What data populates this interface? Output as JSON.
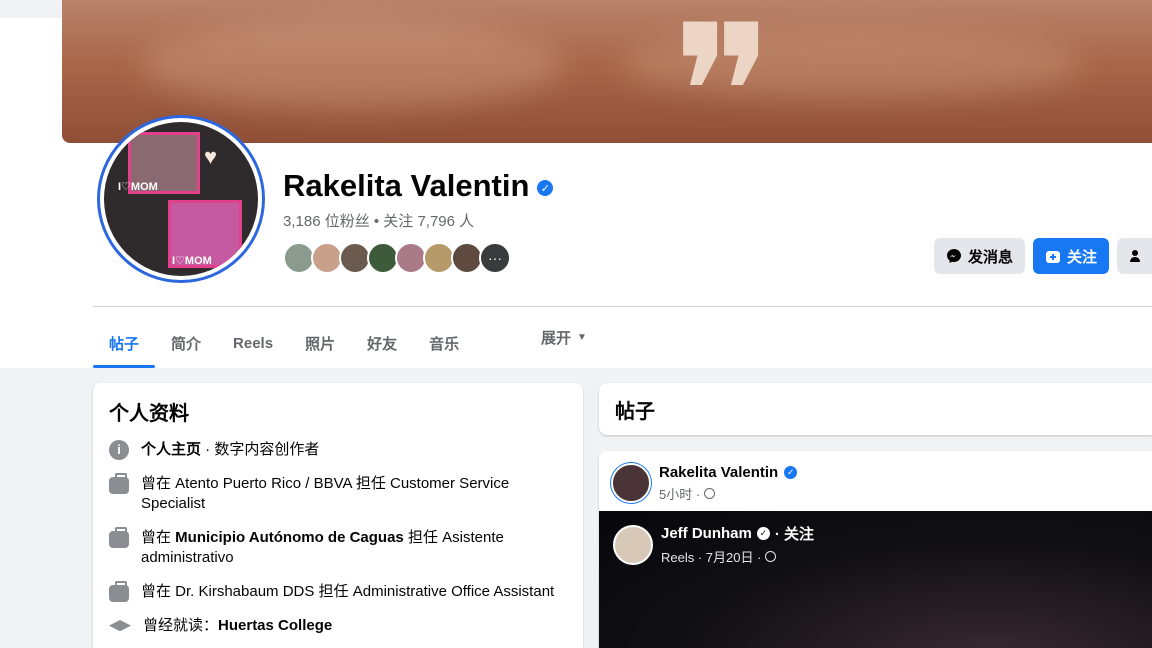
{
  "profile": {
    "name": "Rakelita Valentin",
    "stats": "3,186 位粉丝 • 关注 7,796 人",
    "avatar_text_top": "I♡MOM",
    "avatar_text_bottom": "I♡MOM"
  },
  "friends_avatar_colors": [
    "#8a9b8e",
    "#c9a08a",
    "#6b5a4e",
    "#3d5a3a",
    "#a87b86",
    "#b69a6a",
    "#5e4a3e"
  ],
  "actions": {
    "message_label": "发消息",
    "follow_label": "关注"
  },
  "tabs": [
    {
      "label": "帖子",
      "active": true
    },
    {
      "label": "简介"
    },
    {
      "label": "Reels"
    },
    {
      "label": "照片"
    },
    {
      "label": "好友"
    },
    {
      "label": "音乐"
    }
  ],
  "expand_label": "展开",
  "intro": {
    "title": "个人资料",
    "category_bold": "个人主页",
    "category_rest": " · 数字内容创作者",
    "jobs": [
      {
        "prefix": "曾在 ",
        "org": "Atento Puerto Rico / BBVA",
        "mid": " 担任 ",
        "role": "Customer Service Specialist",
        "org_bold": false
      },
      {
        "prefix": "曾在 ",
        "org": "Municipio Autónomo de Caguas",
        "mid": " 担任 ",
        "role": "Asistente administrativo",
        "org_bold": true
      },
      {
        "prefix": "曾在 ",
        "org": "Dr. Kirshabaum DDS",
        "mid": " 担任 ",
        "role": "Administrative Office Assistant",
        "org_bold": false
      }
    ],
    "education_prefix": "曾经就读：",
    "education_school": "Huertas College"
  },
  "posts": {
    "title": "帖子",
    "post_author": "Rakelita Valentin",
    "post_time": "5小时 ·",
    "reel_author": "Jeff Dunham",
    "reel_follow": "· 关注",
    "reel_meta": "Reels · 7月20日 ·"
  },
  "colors": {
    "accent": "#1877f2",
    "verified": "#1877f2"
  }
}
